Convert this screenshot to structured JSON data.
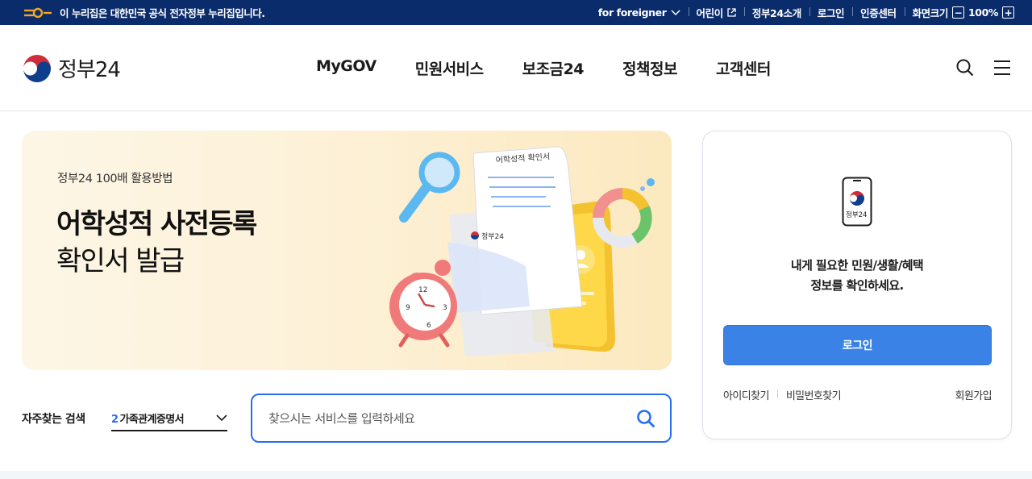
{
  "gov_bar": {
    "notice": "이 누리집은 대한민국 공식 전자정부 누리집입니다.",
    "links": [
      "for foreigner",
      "어린이",
      "정부24소개",
      "로그인",
      "인증센터"
    ],
    "zoom_label": "화면크기",
    "zoom_minus": "−",
    "zoom_value": "100%",
    "zoom_plus": "+"
  },
  "header": {
    "logo_text": "정부24",
    "nav": [
      "MyGOV",
      "민원서비스",
      "보조금24",
      "정책정보",
      "고객센터"
    ],
    "icons": [
      "search-icon",
      "menu-icon"
    ]
  },
  "hero": {
    "subtitle": "정부24 100배 활용방법",
    "title_line1": "어학성적 사전등록",
    "title_line2": "확인서 발급",
    "doc_heading": "어학성적 확인서",
    "doc_logo": "정부24",
    "clock_numbers": [
      "12",
      "3",
      "6",
      "9"
    ]
  },
  "frequent": {
    "label": "자주찾는 검색",
    "selected_number": "2",
    "selected_text": "가족관계증명서"
  },
  "search": {
    "placeholder": "찾으시는 서비스를 입력하세요"
  },
  "login_card": {
    "phone_label": "정부24",
    "message_line1": "내게 필요한 민원/생활/혜택",
    "message_line2": "정보를 확인하세요.",
    "login_button": "로그인",
    "find_id": "아이디찾기",
    "find_password": "비밀번호찾기",
    "signup": "회원가입"
  },
  "colors": {
    "gov_bar_bg": "#0b2c6b",
    "primary_blue": "#256ef4",
    "login_button": "#3b82e6"
  }
}
